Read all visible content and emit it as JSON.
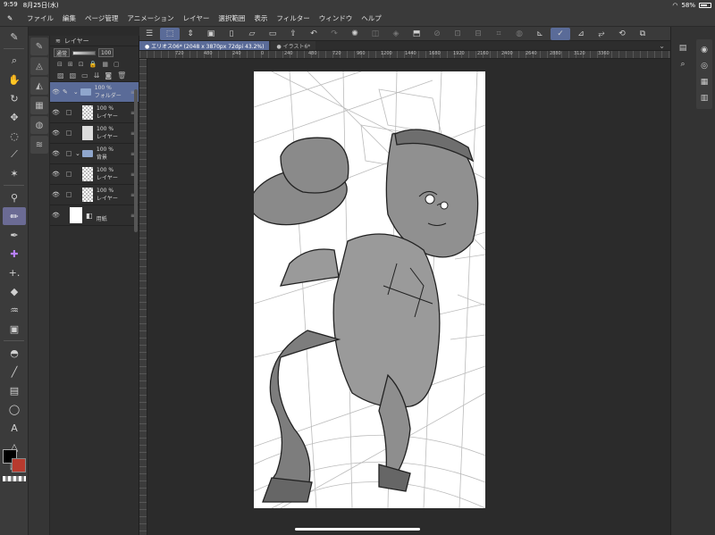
{
  "status": {
    "time": "9:59",
    "date": "8月25日(水)",
    "battery": "58%"
  },
  "menu": {
    "logo": "✎",
    "items": [
      "ファイル",
      "編集",
      "ページ管理",
      "アニメーション",
      "レイヤー",
      "選択範囲",
      "表示",
      "フィルター",
      "ウィンドウ",
      "ヘルプ"
    ]
  },
  "tools": [
    "pen-icon",
    "zoom-icon",
    "hand-icon",
    "rotate-icon",
    "move-icon",
    "lasso-icon",
    "eyedropper-icon",
    "magic-wand-icon",
    "pen-nib-icon",
    "pencil-icon",
    "brush-icon",
    "sparkle-icon",
    "airbrush-icon",
    "eraser-icon",
    "blend-icon",
    "gradient-icon",
    "fill-icon",
    "line-icon",
    "figure-icon",
    "balloon-icon",
    "text-icon",
    "ruler-icon",
    "frame-icon"
  ],
  "layer_panel": {
    "title": "レイヤー",
    "blend_mode": "通常",
    "opacity": "100",
    "layers": [
      {
        "opacity": "100 %",
        "name": "フォルダー",
        "kind": "folder",
        "selected": true,
        "indent": 0
      },
      {
        "opacity": "100 %",
        "name": "レイヤー",
        "kind": "raster",
        "indent": 1
      },
      {
        "opacity": "100 %",
        "name": "レイヤー",
        "kind": "sketch",
        "indent": 1
      },
      {
        "opacity": "100 %",
        "name": "背景",
        "kind": "folder",
        "indent": 0
      },
      {
        "opacity": "100 %",
        "name": "レイヤー",
        "kind": "raster",
        "indent": 1
      },
      {
        "opacity": "100 %",
        "name": "レイヤー",
        "kind": "raster",
        "indent": 1
      },
      {
        "opacity": "",
        "name": "用紙",
        "kind": "paper",
        "indent": 0
      }
    ]
  },
  "tabs": [
    {
      "label": "● エリオス06* (2048 x 3870px 72dpi 43.2%)",
      "active": true
    },
    {
      "label": "● イラスト6*",
      "active": false
    }
  ],
  "ruler": [
    "720",
    "480",
    "240",
    "0",
    "240",
    "480",
    "720",
    "960",
    "1200",
    "1440",
    "1680",
    "1920",
    "2160",
    "2400",
    "2640",
    "2880",
    "3120",
    "3360"
  ],
  "colors": {
    "accent": "#5a6b98",
    "main_color": "#000000",
    "sub_color": "#b83a2e"
  }
}
